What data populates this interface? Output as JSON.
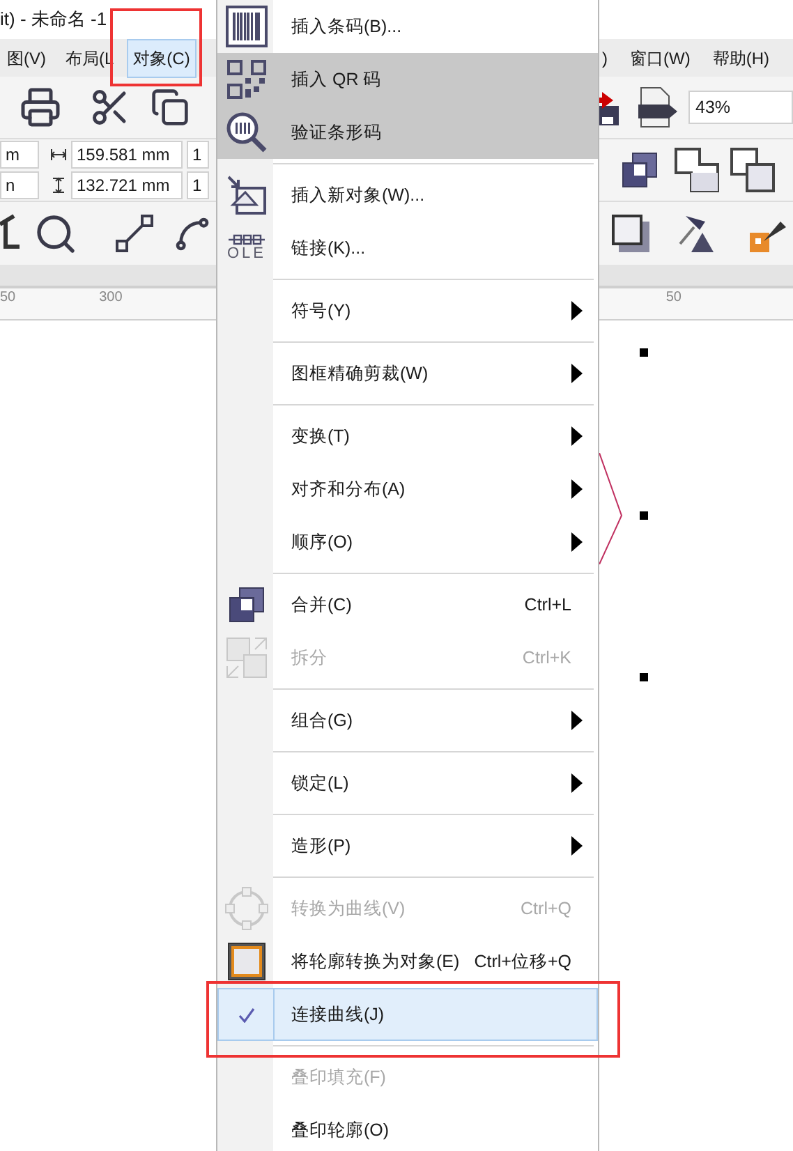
{
  "window": {
    "title": "it) - 未命名 -1"
  },
  "menu_bar": {
    "left": [
      {
        "label": "图(V)",
        "selected": false,
        "annotated": false
      },
      {
        "label": "布局(L",
        "selected": false,
        "annotated": false
      },
      {
        "label": "对象(C)",
        "selected": true,
        "annotated": true
      }
    ],
    "right": [
      {
        "label": ")",
        "selected": false
      },
      {
        "label": "窗口(W)",
        "selected": false
      },
      {
        "label": "帮助(H)",
        "selected": false
      }
    ]
  },
  "toolbar": {
    "zoom": "43%"
  },
  "property_bar": {
    "left_fields": [
      "m",
      "n"
    ],
    "width": "159.581 mm",
    "height": "132.721 mm",
    "right_fields": [
      "1",
      "1"
    ]
  },
  "ruler": {
    "labels": [
      "50",
      "300",
      "50"
    ]
  },
  "menu": [
    {
      "kind": "item",
      "label": "插入条码(B)...",
      "highlighted": false,
      "disabled": false,
      "submenu": false,
      "checked": false,
      "selected": false,
      "annotated": false
    },
    {
      "kind": "item",
      "label": "插入 QR 码",
      "highlighted": true,
      "disabled": false,
      "submenu": false,
      "checked": false,
      "selected": false,
      "annotated": false
    },
    {
      "kind": "item",
      "label": "验证条形码",
      "highlighted": true,
      "disabled": false,
      "submenu": false,
      "checked": false,
      "selected": false,
      "annotated": false
    },
    {
      "kind": "separator"
    },
    {
      "kind": "item",
      "label": "插入新对象(W)...",
      "highlighted": false,
      "disabled": false,
      "submenu": false,
      "checked": false,
      "selected": false,
      "annotated": false
    },
    {
      "kind": "item",
      "label": "链接(K)...",
      "icon_text": "OLE",
      "highlighted": false,
      "disabled": false,
      "submenu": false,
      "checked": false,
      "selected": false,
      "annotated": false
    },
    {
      "kind": "separator"
    },
    {
      "kind": "item",
      "label": "符号(Y)",
      "highlighted": false,
      "disabled": false,
      "submenu": true,
      "checked": false,
      "selected": false,
      "annotated": false
    },
    {
      "kind": "separator"
    },
    {
      "kind": "item",
      "label": "图框精确剪裁(W)",
      "highlighted": false,
      "disabled": false,
      "submenu": true,
      "checked": false,
      "selected": false,
      "annotated": false
    },
    {
      "kind": "separator"
    },
    {
      "kind": "item",
      "label": "变换(T)",
      "highlighted": false,
      "disabled": false,
      "submenu": true,
      "checked": false,
      "selected": false,
      "annotated": false
    },
    {
      "kind": "item",
      "label": "对齐和分布(A)",
      "highlighted": false,
      "disabled": false,
      "submenu": true,
      "checked": false,
      "selected": false,
      "annotated": false
    },
    {
      "kind": "item",
      "label": "顺序(O)",
      "highlighted": false,
      "disabled": false,
      "submenu": true,
      "checked": false,
      "selected": false,
      "annotated": false
    },
    {
      "kind": "separator"
    },
    {
      "kind": "item",
      "label": "合并(C)",
      "shortcut": "Ctrl+L",
      "highlighted": false,
      "disabled": false,
      "submenu": false,
      "checked": false,
      "selected": false,
      "annotated": false
    },
    {
      "kind": "item",
      "label": "拆分",
      "shortcut": "Ctrl+K",
      "highlighted": false,
      "disabled": true,
      "submenu": false,
      "checked": false,
      "selected": false,
      "annotated": false
    },
    {
      "kind": "separator"
    },
    {
      "kind": "item",
      "label": "组合(G)",
      "highlighted": false,
      "disabled": false,
      "submenu": true,
      "checked": false,
      "selected": false,
      "annotated": false
    },
    {
      "kind": "separator"
    },
    {
      "kind": "item",
      "label": "锁定(L)",
      "highlighted": false,
      "disabled": false,
      "submenu": true,
      "checked": false,
      "selected": false,
      "annotated": false
    },
    {
      "kind": "separator"
    },
    {
      "kind": "item",
      "label": "造形(P)",
      "highlighted": false,
      "disabled": false,
      "submenu": true,
      "checked": false,
      "selected": false,
      "annotated": false
    },
    {
      "kind": "separator"
    },
    {
      "kind": "item",
      "label": "转换为曲线(V)",
      "shortcut": "Ctrl+Q",
      "highlighted": false,
      "disabled": true,
      "submenu": false,
      "checked": false,
      "selected": false,
      "annotated": false
    },
    {
      "kind": "item",
      "label": "将轮廓转换为对象(E)",
      "shortcut": "Ctrl+位移+Q",
      "highlighted": false,
      "disabled": false,
      "submenu": false,
      "checked": false,
      "selected": false,
      "annotated": false
    },
    {
      "kind": "item",
      "label": "连接曲线(J)",
      "highlighted": false,
      "disabled": false,
      "submenu": false,
      "checked": true,
      "selected": true,
      "annotated": true
    },
    {
      "kind": "separator"
    },
    {
      "kind": "item",
      "label": "叠印填充(F)",
      "highlighted": false,
      "disabled": true,
      "submenu": false,
      "checked": false,
      "selected": false,
      "annotated": false
    },
    {
      "kind": "item",
      "label": "叠印轮廓(O)",
      "highlighted": false,
      "disabled": false,
      "submenu": false,
      "checked": false,
      "selected": false,
      "annotated": false
    }
  ]
}
